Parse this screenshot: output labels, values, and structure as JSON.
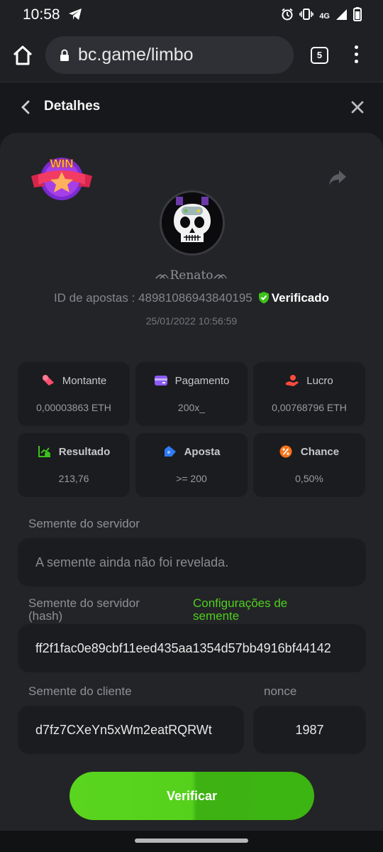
{
  "status_bar": {
    "time": "10:58",
    "network": "4G"
  },
  "browser": {
    "url": "bc.game/limbo",
    "tab_count": "5"
  },
  "details": {
    "title": "Detalhes",
    "win_badge": "WIN",
    "username": "ᨏRenatoᨏ",
    "bet_id_label": "ID de apostas : ",
    "bet_id": "48981086943840195",
    "verified": "Verificado",
    "timestamp": "25/01/2022 10:56:59"
  },
  "stats": [
    {
      "label": "Montante",
      "value": "0,00003863 ETH",
      "icon": "coins-icon",
      "color": "#ff4d6d"
    },
    {
      "label": "Pagamento",
      "value": "200x_",
      "icon": "wallet-icon",
      "color": "#8b5cf6"
    },
    {
      "label": "Lucro",
      "value": "0,00768796 ETH",
      "icon": "hand-coin-icon",
      "color": "#ff4b3e"
    },
    {
      "label": "Resultado",
      "value": "213,76",
      "icon": "chart-check-icon",
      "color": "#3ec21c"
    },
    {
      "label": "Aposta",
      "value": ">= 200",
      "icon": "ticket-icon",
      "color": "#2f7bf5"
    },
    {
      "label": "Chance",
      "value": "0,50%",
      "icon": "percent-icon",
      "color": "#f97316"
    }
  ],
  "seeds": {
    "server_seed_label": "Semente do servidor",
    "server_seed_value": "A semente ainda não foi revelada.",
    "server_hash_label": "Semente do servidor (hash)",
    "seed_settings_link": "Configurações de semente",
    "server_hash_value": "ff2f1fac0e89cbf11eed435aa1354d57bb4916bf44142",
    "client_seed_label": "Semente do cliente",
    "client_seed_value": "d7fz7CXeYn5xWm2eatRQRWt",
    "nonce_label": "nonce",
    "nonce_value": "1987"
  },
  "verify_button": "Verificar"
}
